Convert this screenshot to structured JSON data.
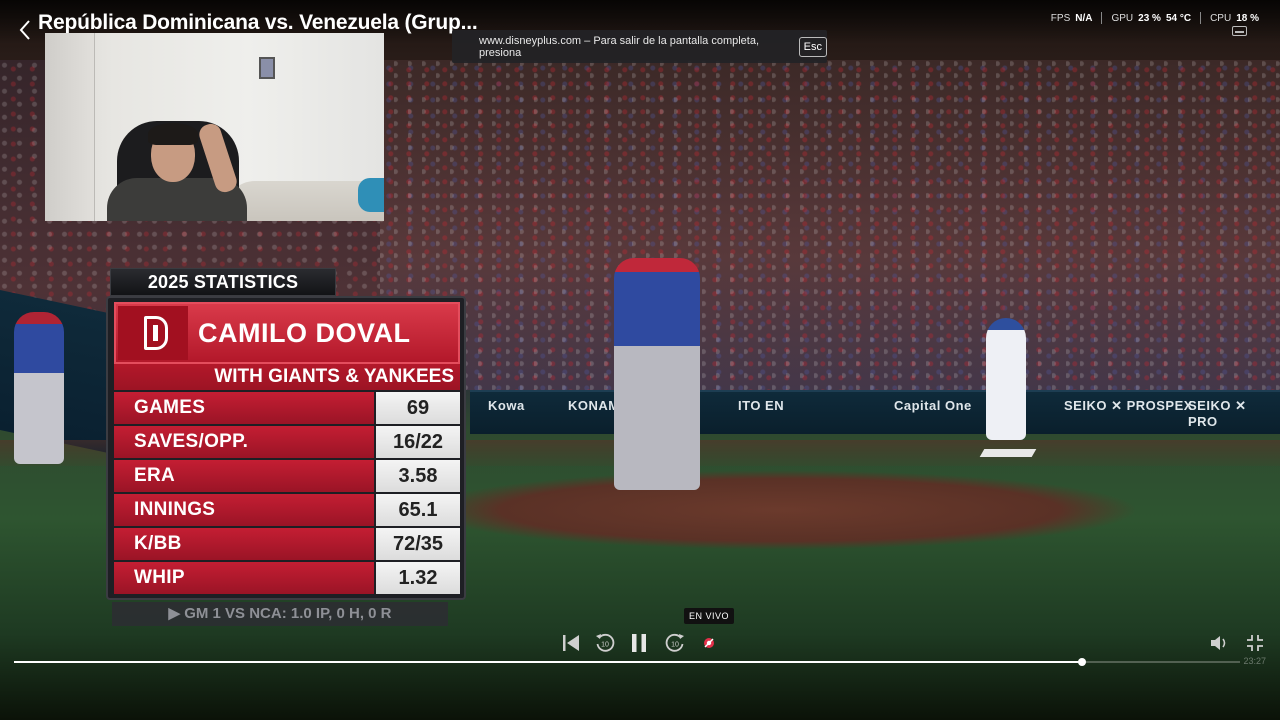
{
  "header": {
    "title": "República Dominicana vs. Venezuela (Grup..."
  },
  "fullscreen_toast": {
    "message": "www.disneyplus.com – Para salir de la pantalla completa, presiona",
    "key": "Esc"
  },
  "perf_overlay": {
    "fps_label": "FPS",
    "fps_value": "N/A",
    "gpu_label": "GPU",
    "gpu_usage": "23 %",
    "gpu_temp": "54 °C",
    "cpu_label": "CPU",
    "cpu_usage": "18 %"
  },
  "scoreboard": {
    "header": "2025 STATISTICS",
    "player_name": "CAMILO DOVAL",
    "subtitle": "WITH GIANTS & YANKEES",
    "stats": [
      {
        "label": "GAMES",
        "value": "69"
      },
      {
        "label": "SAVES/OPP.",
        "value": "16/22"
      },
      {
        "label": "ERA",
        "value": "3.58"
      },
      {
        "label": "INNINGS",
        "value": "65.1"
      },
      {
        "label": "K/BB",
        "value": "72/35"
      },
      {
        "label": "WHIP",
        "value": "1.32"
      }
    ],
    "last_game": "▶ GM 1 VS NCA: 1.0 IP, 0 H, 0 R"
  },
  "ads": [
    "Kowa",
    "KONAMI",
    "ITO EN",
    "Capital One",
    "SEIKO ✕ PROSPEX",
    "SEIKO ✕ PRO"
  ],
  "player_controls": {
    "live_label": "EN VIVO",
    "progress_fraction": 0.871,
    "time_end": "23:27"
  },
  "icons": {
    "back": "chevron-left-icon",
    "skip_start": "skip-to-start-icon",
    "rewind": "rewind-10-icon",
    "pause": "pause-icon",
    "forward": "forward-10-icon",
    "live": "live-indicator-icon",
    "volume": "volume-icon",
    "exit_fullscreen": "exit-fullscreen-icon"
  },
  "colors": {
    "accent_red": "#c41e33",
    "live_red": "#e3304a"
  }
}
